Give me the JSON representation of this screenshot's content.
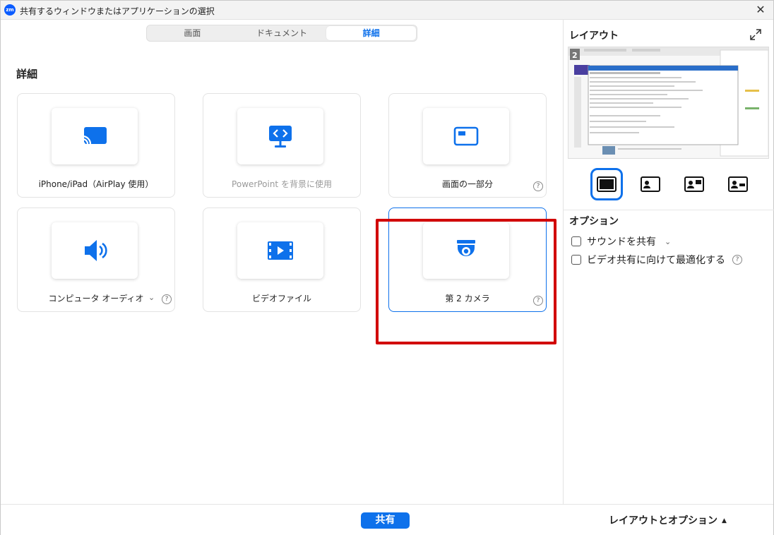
{
  "window": {
    "title": "共有するウィンドウまたはアプリケーションの選択",
    "logo_text": "zm",
    "close_label": "✕"
  },
  "tabs": [
    {
      "label": "画面",
      "active": false
    },
    {
      "label": "ドキュメント",
      "active": false
    },
    {
      "label": "詳細",
      "active": true
    }
  ],
  "section_title": "詳細",
  "cards": [
    {
      "label": "iPhone/iPad（AirPlay 使用）",
      "icon": "airplay-icon",
      "disabled": false
    },
    {
      "label": "PowerPoint を背景に使用",
      "icon": "powerpoint-background-icon",
      "disabled": true
    },
    {
      "label": "画面の一部分",
      "icon": "screen-portion-icon",
      "help": "?"
    },
    {
      "label": "コンピュータ オーディオ",
      "icon": "speaker-icon",
      "chevron": "⌄",
      "help": "?"
    },
    {
      "label": "ビデオファイル",
      "icon": "video-file-icon"
    },
    {
      "label": "第 2 カメラ",
      "icon": "camera-icon",
      "help": "?",
      "selected": true
    }
  ],
  "right_panel": {
    "layout_title": "レイアウト",
    "preview_badge": "2",
    "options_title": "オプション",
    "options": [
      {
        "label": "サウンドを共有",
        "chevron": "⌄",
        "checked": false
      },
      {
        "label": "ビデオ共有に向けて最適化する",
        "help": "?",
        "checked": false
      }
    ]
  },
  "bottom": {
    "share_label": "共有",
    "layout_toggle_label": "レイアウトとオプション",
    "caret": "▲"
  },
  "colors": {
    "accent": "#0e71eb",
    "highlight": "#d10000"
  }
}
